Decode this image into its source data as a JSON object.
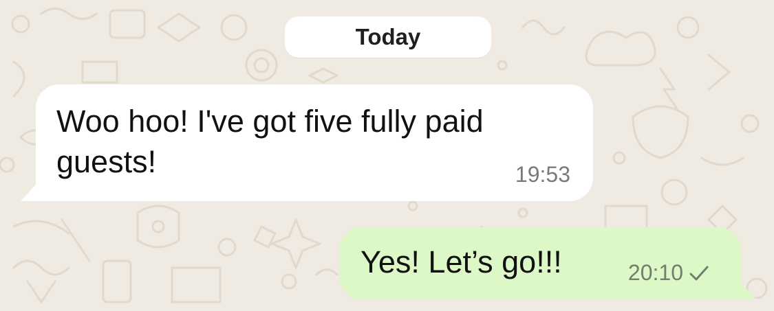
{
  "date_divider": {
    "label": "Today"
  },
  "messages": [
    {
      "direction": "incoming",
      "text": "Woo hoo! I've got five fully paid guests!",
      "time": "19:53"
    },
    {
      "direction": "outgoing",
      "text": "Yes! Let’s go!!!",
      "time": "20:10",
      "status_icon": "single-check-icon"
    }
  ],
  "colors": {
    "wallpaper": "#efeae2",
    "incoming_bubble": "#ffffff",
    "outgoing_bubble": "#dcf8c6",
    "timestamp": "#7a7a7a"
  }
}
